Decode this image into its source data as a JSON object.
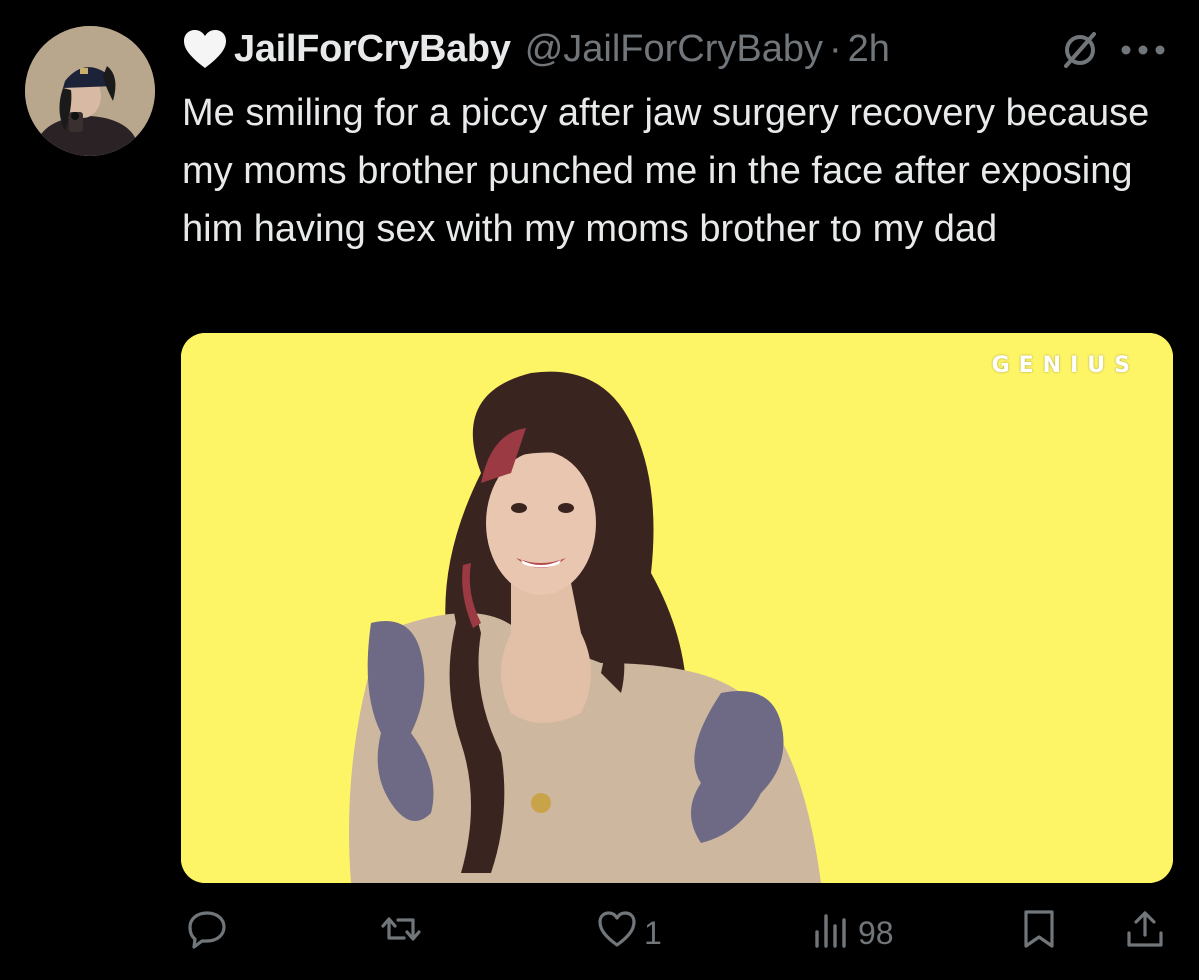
{
  "tweet": {
    "display_name": "JailForCryBaby",
    "handle": "@JailForCryBaby",
    "separator": "·",
    "time": "2h",
    "text": "Me smiling for a piccy after jaw surgery recovery because my moms brother punched me in the face after exposing him having sex with my moms brother to my dad",
    "media": {
      "watermark": "GENIUS",
      "background_color": "#fdf466"
    }
  },
  "actions": {
    "reply": {
      "icon": "reply-icon",
      "count": ""
    },
    "retweet": {
      "icon": "retweet-icon",
      "count": ""
    },
    "like": {
      "icon": "like-icon",
      "count": "1"
    },
    "views": {
      "icon": "views-icon",
      "count": "98"
    },
    "bookmark": {
      "icon": "bookmark-icon"
    },
    "share": {
      "icon": "share-icon"
    }
  },
  "colors": {
    "background": "#000000",
    "text_primary": "#e7e9ea",
    "text_secondary": "#71767b"
  }
}
